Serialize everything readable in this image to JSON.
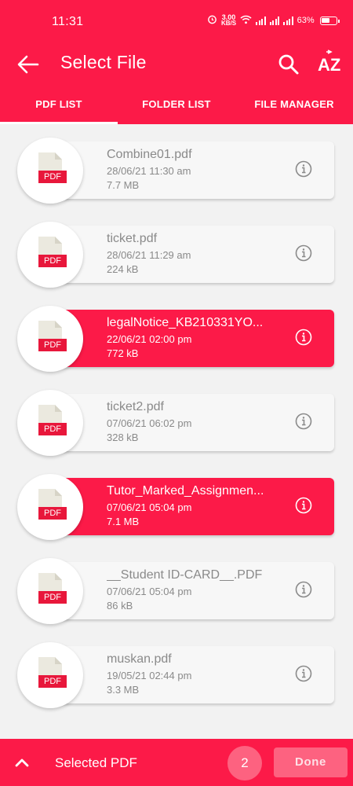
{
  "status_bar": {
    "time": "11:31",
    "net_speed_value": "3.00",
    "net_speed_unit": "KB/S",
    "battery": "63%",
    "battery_level": 0.63
  },
  "appbar": {
    "title": "Select File",
    "icons": [
      "arrow-back-icon",
      "search-icon",
      "sort-az-icon"
    ],
    "sort_label": "AZ"
  },
  "tabs": [
    {
      "label": "PDF LIST",
      "active": true
    },
    {
      "label": "FOLDER LIST",
      "active": false
    },
    {
      "label": "FILE MANAGER",
      "active": false
    }
  ],
  "files": [
    {
      "name": "Combine01.pdf",
      "date": "28/06/21  11:30 am",
      "size": "7.7 MB",
      "selected": false,
      "badge": "PDF"
    },
    {
      "name": "ticket.pdf",
      "date": "28/06/21  11:29 am",
      "size": "224 kB",
      "selected": false,
      "badge": "PDF"
    },
    {
      "name": "legalNotice_KB210331YO...",
      "date": "22/06/21  02:00 pm",
      "size": "772 kB",
      "selected": true,
      "badge": "PDF"
    },
    {
      "name": "ticket2.pdf",
      "date": "07/06/21  06:02 pm",
      "size": "328 kB",
      "selected": false,
      "badge": "PDF"
    },
    {
      "name": "Tutor_Marked_Assignmen...",
      "date": "07/06/21  05:04 pm",
      "size": "7.1 MB",
      "selected": true,
      "badge": "PDF"
    },
    {
      "name": "__Student ID-CARD__.PDF",
      "date": "07/06/21  05:04 pm",
      "size": "86 kB",
      "selected": false,
      "badge": "PDF"
    },
    {
      "name": "muskan.pdf",
      "date": "19/05/21  02:44 pm",
      "size": "3.3 MB",
      "selected": false,
      "badge": "PDF"
    }
  ],
  "bottom_bar": {
    "label": "Selected PDF",
    "count": "2",
    "done_label": "Done"
  },
  "colors": {
    "accent": "#fc1a48",
    "accent_light": "#fd6280",
    "pdf_badge": "#e8173b",
    "text_muted": "#8a8a8a"
  }
}
